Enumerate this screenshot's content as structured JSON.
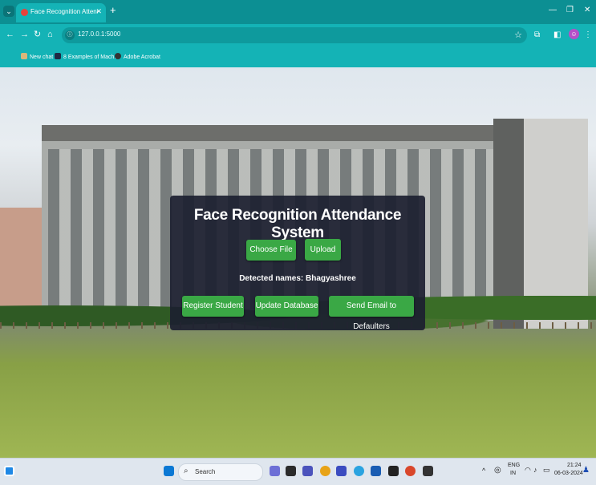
{
  "browser": {
    "tab_title": "Face Recognition Attendance Sy",
    "url": "127.0.0.1:5000",
    "new_tab": "+",
    "bookmarks": [
      {
        "label": "New chat",
        "color": "#d9b77a"
      },
      {
        "label": "8 Examples of Mach...",
        "color": "#1f2a44"
      },
      {
        "label": "Adobe Acrobat",
        "color": "#333333"
      }
    ]
  },
  "app": {
    "title": "Face Recognition Attendance System",
    "choose_file": "Choose File",
    "upload": "Upload",
    "detected": "Detected names: Bhagyashree",
    "register": "Register Student",
    "update_db": "Update Database",
    "send_email": "Send Email to Defaulters"
  },
  "taskbar": {
    "search": "Search",
    "lang_top": "ENG",
    "lang_bottom": "IN",
    "time": "21:24",
    "date": "06-03-2024"
  },
  "colors": {
    "button_green": "#3aa845",
    "card_bg": "#1c2030",
    "chrome_teal": "#14b3b6"
  }
}
